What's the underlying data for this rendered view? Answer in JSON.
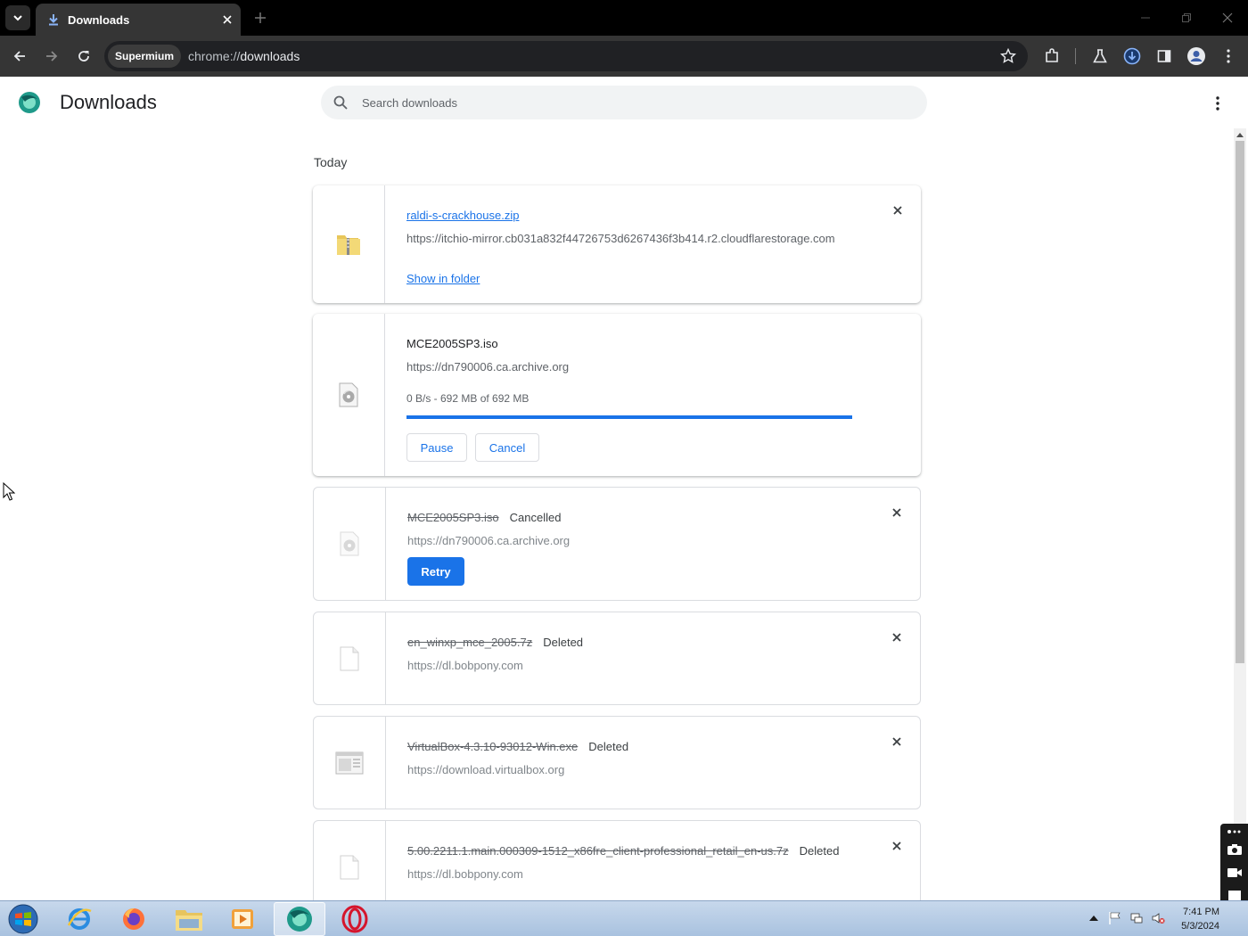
{
  "browser": {
    "tab_title": "Downloads",
    "origin_chip": "Supermium",
    "url_scheme": "chrome://",
    "url_host": "downloads"
  },
  "page": {
    "title": "Downloads",
    "search_placeholder": "Search downloads",
    "date_header": "Today"
  },
  "downloads": [
    {
      "filename": "raldi-s-crackhouse.zip",
      "url": "https://itchio-mirror.cb031a832f44726753d6267436f3b414.r2.cloudflarestorage.com",
      "action": "Show in folder",
      "icon": "zip-folder-icon"
    },
    {
      "filename": "MCE2005SP3.iso",
      "url": "https://dn790006.ca.archive.org",
      "status": "0 B/s - 692 MB of 692 MB",
      "progress": 1.0,
      "pause_label": "Pause",
      "cancel_label": "Cancel",
      "icon": "disc-image-icon"
    },
    {
      "filename": "MCE2005SP3.iso",
      "tag": "Cancelled",
      "url": "https://dn790006.ca.archive.org",
      "retry_label": "Retry",
      "icon": "disc-image-icon"
    },
    {
      "filename": "en_winxp_mce_2005.7z",
      "tag": "Deleted",
      "url": "https://dl.bobpony.com",
      "icon": "file-icon"
    },
    {
      "filename": "VirtualBox-4.3.10-93012-Win.exe",
      "tag": "Deleted",
      "url": "https://download.virtualbox.org",
      "icon": "exe-icon"
    },
    {
      "filename": "5.00.2211.1.main.000309-1512_x86fre_client-professional_retail_en-us.7z",
      "tag": "Deleted",
      "url": "https://dl.bobpony.com",
      "icon": "file-icon"
    }
  ],
  "taskbar": {
    "time": "7:41 PM",
    "date": "5/3/2024"
  },
  "colors": {
    "accent": "#1a73e8",
    "toolbar": "#353535",
    "tabstrip": "#000000"
  }
}
